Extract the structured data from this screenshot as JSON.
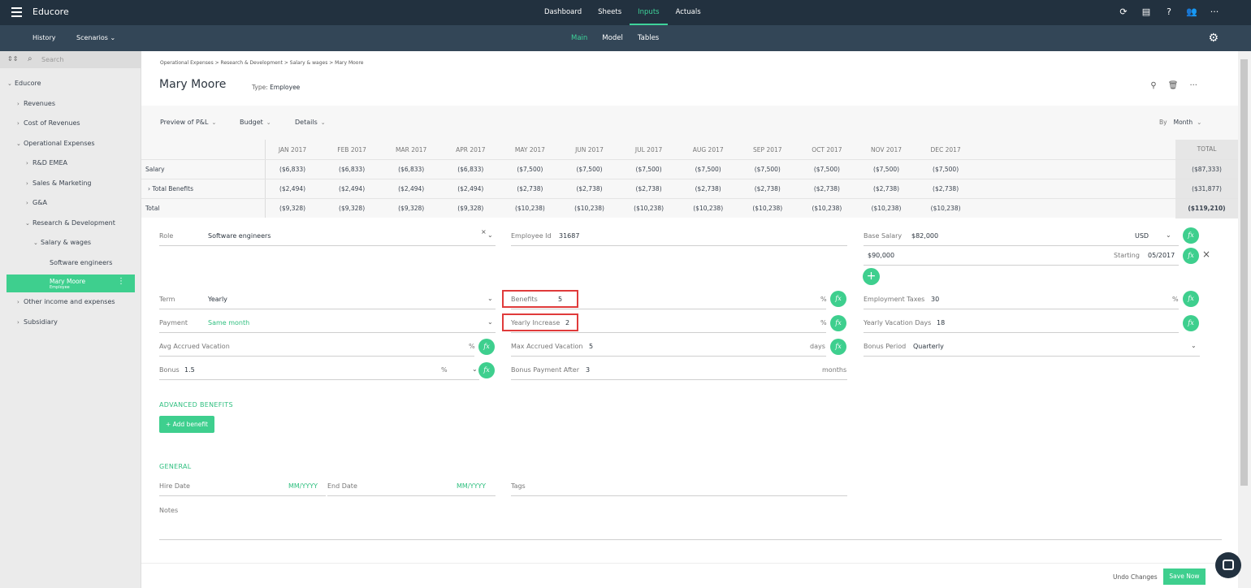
{
  "app": {
    "title": "Educore"
  },
  "topnav": [
    "Dashboard",
    "Sheets",
    "Inputs",
    "Actuals"
  ],
  "subbar": {
    "history": "History",
    "scenarios": "Scenarios",
    "tabs": [
      "Main",
      "Model",
      "Tables"
    ]
  },
  "sidebar": {
    "search_placeholder": "Search",
    "items": [
      {
        "label": "Educore"
      },
      {
        "label": "Revenues"
      },
      {
        "label": "Cost of Revenues"
      },
      {
        "label": "Operational Expenses"
      },
      {
        "label": "R&D EMEA"
      },
      {
        "label": "Sales & Marketing"
      },
      {
        "label": "G&A"
      },
      {
        "label": "Research & Development"
      },
      {
        "label": "Salary & wages"
      },
      {
        "label": "Software engineers"
      },
      {
        "label": "Mary Moore",
        "sub": "Employee"
      },
      {
        "label": "Other income and expenses"
      },
      {
        "label": "Subsidiary"
      }
    ]
  },
  "page": {
    "breadcrumb": "Operational Expenses > Research & Development > Salary & wages > Mary Moore",
    "title": "Mary Moore",
    "type_label": "Type:",
    "type_value": "Employee"
  },
  "toolbar": {
    "preview": "Preview of P&L",
    "budget": "Budget",
    "details": "Details",
    "by_label": "By",
    "by_value": "Month"
  },
  "table": {
    "columns": [
      "JAN 2017",
      "FEB 2017",
      "MAR 2017",
      "APR 2017",
      "MAY 2017",
      "JUN 2017",
      "JUL 2017",
      "AUG 2017",
      "SEP 2017",
      "OCT 2017",
      "NOV 2017",
      "DEC 2017"
    ],
    "total_header": "TOTAL",
    "rows": [
      {
        "label": "Salary",
        "values": [
          "($6,833)",
          "($6,833)",
          "($6,833)",
          "($6,833)",
          "($7,500)",
          "($7,500)",
          "($7,500)",
          "($7,500)",
          "($7,500)",
          "($7,500)",
          "($7,500)",
          "($7,500)"
        ],
        "total": "($87,333)"
      },
      {
        "label": "Total Benefits",
        "values": [
          "($2,494)",
          "($2,494)",
          "($2,494)",
          "($2,494)",
          "($2,738)",
          "($2,738)",
          "($2,738)",
          "($2,738)",
          "($2,738)",
          "($2,738)",
          "($2,738)",
          "($2,738)"
        ],
        "total": "($31,877)"
      },
      {
        "label": "Total",
        "values": [
          "($9,328)",
          "($9,328)",
          "($9,328)",
          "($9,328)",
          "($10,238)",
          "($10,238)",
          "($10,238)",
          "($10,238)",
          "($10,238)",
          "($10,238)",
          "($10,238)",
          "($10,238)"
        ],
        "total": "($119,210)"
      }
    ]
  },
  "form": {
    "role_label": "Role",
    "role_value": "Software engineers",
    "empid_label": "Employee Id",
    "empid_value": "31687",
    "base_label": "Base Salary",
    "base_value": "$82,000",
    "currency": "USD",
    "salary2_value": "$90,000",
    "starting_label": "Starting",
    "starting_value": "05/2017",
    "term_label": "Term",
    "term_value": "Yearly",
    "benefits_label": "Benefits",
    "benefits_value": "5",
    "pct": "%",
    "emptax_label": "Employment Taxes",
    "emptax_value": "30",
    "payment_label": "Payment",
    "payment_value": "Same month",
    "yinc_label": "Yearly Increase",
    "yinc_value": "2",
    "yvac_label": "Yearly Vacation Days",
    "yvac_value": "18",
    "avgvac_label": "Avg Accrued Vacation",
    "maxvac_label": "Max Accrued Vacation",
    "maxvac_value": "5",
    "days": "days",
    "bonusperiod_label": "Bonus Period",
    "bonusperiod_value": "Quarterly",
    "bonus_label": "Bonus",
    "bonus_value": "1.5",
    "bonuspay_label": "Bonus Payment After",
    "bonuspay_value": "3",
    "months": "months",
    "fx": "fx"
  },
  "advanced": {
    "title": "ADVANCED BENEFITS",
    "add": "+ Add benefit"
  },
  "general": {
    "title": "GENERAL",
    "hire_label": "Hire Date",
    "hire_ph": "MM/YYYY",
    "end_label": "End Date",
    "end_ph": "MM/YYYY",
    "tags_label": "Tags",
    "notes_label": "Notes"
  },
  "footer": {
    "undo": "Undo Changes",
    "save": "Save Now"
  }
}
